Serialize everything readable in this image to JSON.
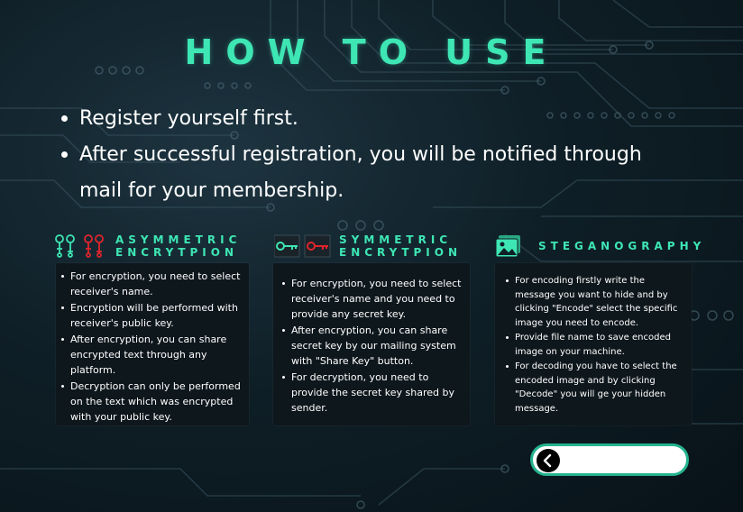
{
  "title": "HOW TO USE",
  "steps": [
    "Register yourself first.",
    "After successful registration, you will be notified through mail for your membership."
  ],
  "sections": [
    {
      "title": "ASYMMETRIC ENCRYTPION",
      "icon": "key-pair-icon",
      "items": [
        "For encryption, you need to select receiver's name.",
        "Encryption will be performed with receiver's public key.",
        "After encryption, you can share encrypted text through any platform.",
        "Decryption can only be performed on the text which was encrypted with your public key."
      ]
    },
    {
      "title": "SYMMETRIC ENCRYTPION",
      "icon": "keys-icon",
      "items": [
        "For encryption, you need to select receiver's name and you need to provide any secret key.",
        "After encryption, you can share secret key by our mailing system with \"Share Key\" button.",
        "For decryption, you need to provide the secret key shared by sender."
      ]
    },
    {
      "title": "STEGANOGRAPHY",
      "icon": "image-icon",
      "items": [
        "For encoding firstly write the message you want to hide and by clicking \"Encode\" select the specific image you need to encode.",
        "Provide file name to save encoded image on your machine.",
        "For decoding you have to select the encoded image and by clicking \"Decode\" you will ge your hidden message."
      ]
    }
  ],
  "back_button": {
    "icon": "chevron-left-icon"
  },
  "colors": {
    "accent": "#3ee6b4",
    "background": "#0f1f27",
    "card": "#0e171c",
    "key_red": "#e0242c"
  }
}
